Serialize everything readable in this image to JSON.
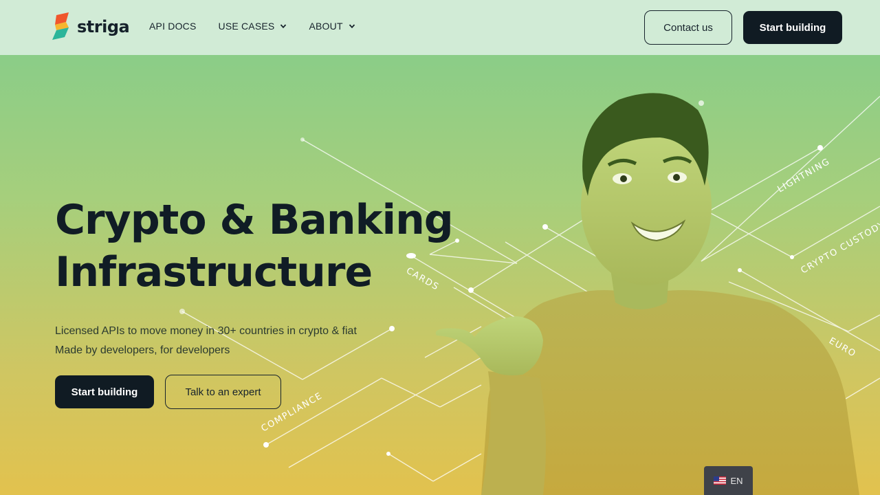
{
  "brand": {
    "name": "striga"
  },
  "nav": {
    "items": [
      {
        "label": "API DOCS",
        "has_dropdown": false
      },
      {
        "label": "USE CASES",
        "has_dropdown": true
      },
      {
        "label": "ABOUT",
        "has_dropdown": true
      }
    ],
    "contact_label": "Contact us",
    "start_label": "Start building"
  },
  "hero": {
    "title_line1": "Crypto & Banking",
    "title_line2": "Infrastructure",
    "subtitle_line1": "Licensed APIs to move money in 30+ countries in crypto & fiat",
    "subtitle_line2": "Made by developers, for developers",
    "primary_cta": "Start building",
    "secondary_cta": "Talk to an expert"
  },
  "network_labels": {
    "lightning": "LIGHTNING",
    "crypto_custody": "CRYPTO CUSTODY",
    "cards": "CARDS",
    "euro": "EURO",
    "compliance": "COMPLIANCE"
  },
  "language": {
    "code": "EN",
    "flag": "us-flag-icon"
  },
  "colors": {
    "header_bg": "#d1ebd6",
    "dark": "#101b23",
    "gradient_top": "#80cc8c",
    "gradient_bottom": "#e2c24e"
  }
}
